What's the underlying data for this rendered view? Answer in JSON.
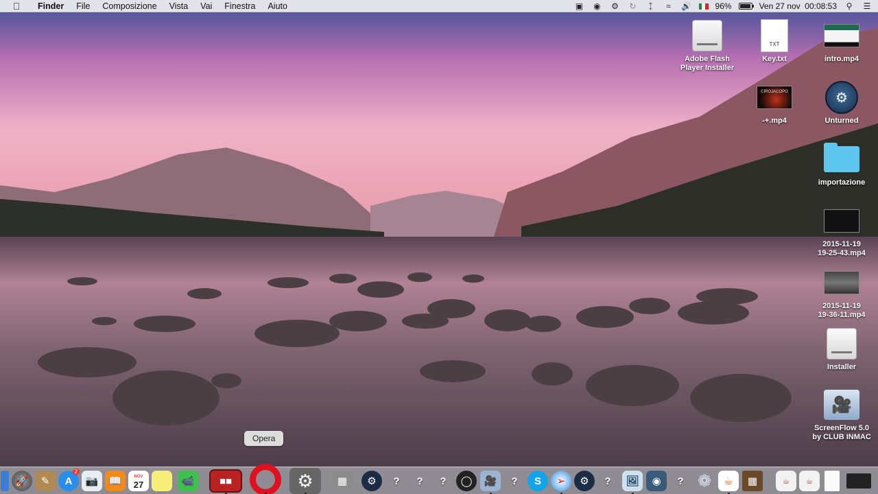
{
  "menubar": {
    "app_name": "Finder",
    "items": [
      "File",
      "Composizione",
      "Vista",
      "Vai",
      "Finestra",
      "Aiuto"
    ],
    "battery_percent": "96%",
    "battery_level": 0.96,
    "datetime": "Ven 27 nov  00:08:53"
  },
  "desktop_icons": [
    {
      "label": "Adobe Flash\nPlayer Installer",
      "icon": "disk-image-icon"
    },
    {
      "label": "Key.txt",
      "icon": "text-file-icon",
      "badge": "TXT"
    },
    {
      "label": "intro.mp4",
      "icon": "video-file-icon"
    },
    {
      "label": "-+.mp4",
      "icon": "video-file-icon",
      "thumb_text": "CIROJACOPO"
    },
    {
      "label": "Unturned",
      "icon": "steam-icon"
    },
    {
      "label": "importazione",
      "icon": "folder-icon"
    },
    {
      "label": "2015-11-19\n19-25-43.mp4",
      "icon": "video-file-icon"
    },
    {
      "label": "2015-11-19\n19-36-11.mp4",
      "icon": "video-file-icon"
    },
    {
      "label": "Installer",
      "icon": "disk-image-icon"
    },
    {
      "label": "ScreenFlow 5.0\nby CLUB INMAC",
      "icon": "screenflow-icon"
    }
  ],
  "tooltip": "Opera",
  "dock": {
    "calendar_month": "NOV",
    "calendar_day": "27",
    "apps": [
      "finder-icon",
      "launchpad-icon",
      "notes-app-icon",
      "app-store-icon",
      "preview-icon",
      "ibooks-icon",
      "calendar-icon",
      "stickies-icon",
      "facetime-icon",
      "photo-booth-icon",
      "opera-icon",
      "system-preferences-icon",
      "calculator-icon",
      "steam-icon",
      "unknown-app-icon",
      "unknown-app-icon",
      "unknown-app-icon",
      "obs-icon",
      "screenflow-icon",
      "unknown-app-icon",
      "skype-icon",
      "safari-icon",
      "steam-icon",
      "unknown-app-icon",
      "preview-icon",
      "chrome-icon",
      "unknown-app-icon",
      "settings-gear-icon",
      "java-icon",
      "minecraft-icon",
      "java-jar-icon",
      "java-jar-icon",
      "document-icon",
      "terminal-icon"
    ],
    "badge_count": "2"
  }
}
